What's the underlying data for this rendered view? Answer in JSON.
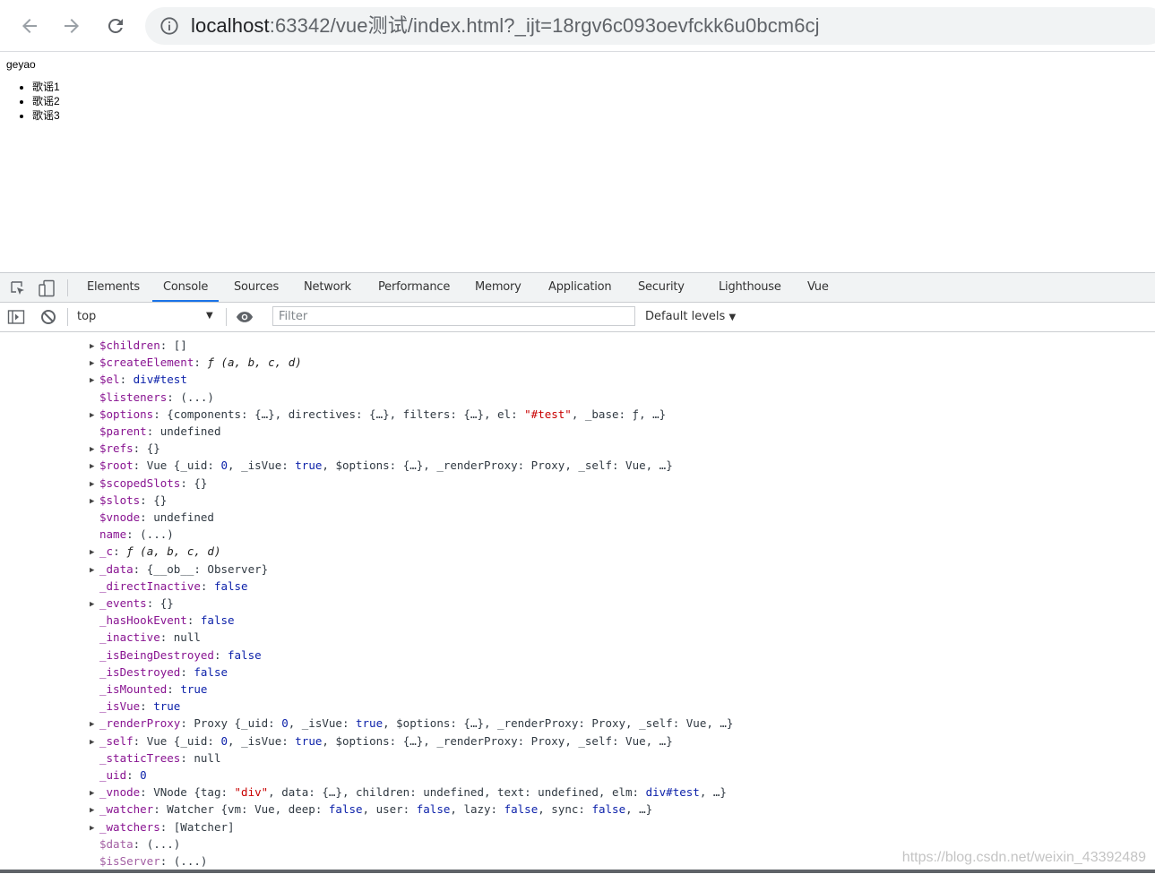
{
  "browser": {
    "url_host": "localhost",
    "url_rest": ":63342/vue测试/index.html?_ijt=18rgv6c093oevfckk6u0bcm6cj"
  },
  "page": {
    "name": "geyao",
    "songs": [
      "歌谣1",
      "歌谣2",
      "歌谣3"
    ]
  },
  "devtools": {
    "tabs": [
      "Elements",
      "Console",
      "Sources",
      "Network",
      "Performance",
      "Memory",
      "Application",
      "Security",
      "Lighthouse",
      "Vue"
    ],
    "active_tab": "Console",
    "context": "top",
    "filter_placeholder": "Filter",
    "levels": "Default levels"
  },
  "console_lines": [
    "$children: []",
    "$createElement: ƒ (a, b, c, d)",
    "$el: div#test",
    "$listeners: (...)",
    "$options: {components: {…}, directives: {…}, filters: {…}, el: \"#test\", _base: ƒ, …}",
    "$parent: undefined",
    "$refs: {}",
    "$root: Vue {_uid: 0, _isVue: true, $options: {…}, _renderProxy: Proxy, _self: Vue, …}",
    "$scopedSlots: {}",
    "$slots: {}",
    "$vnode: undefined",
    "name: (...)",
    "_c: ƒ (a, b, c, d)",
    "_data: {__ob__: Observer}",
    "_directInactive: false",
    "_events: {}",
    "_hasHookEvent: false",
    "_inactive: null",
    "_isBeingDestroyed: false",
    "_isDestroyed: false",
    "_isMounted: true",
    "_isVue: true",
    "_renderProxy: Proxy {_uid: 0, _isVue: true, $options: {…}, _renderProxy: Proxy, _self: Vue, …}",
    "_self: Vue {_uid: 0, _isVue: true, $options: {…}, _renderProxy: Proxy, _self: Vue, …}",
    "_staticTrees: null",
    "_uid: 0",
    "_vnode: VNode {tag: \"div\", data: {…}, children: undefined, text: undefined, elm: div#test, …}",
    "_watcher: Watcher {vm: Vue, deep: false, user: false, lazy: false, sync: false, …}",
    "_watchers: [Watcher]",
    "$data: (...)",
    "$isServer: (...)"
  ],
  "watermark": "https://blog.csdn.net/weixin_43392489",
  "colors": {
    "tab_underline": "#1a73e8",
    "key_purple": "#881391",
    "keyword_blue": "#0d22aa",
    "string_red": "#c80000"
  }
}
